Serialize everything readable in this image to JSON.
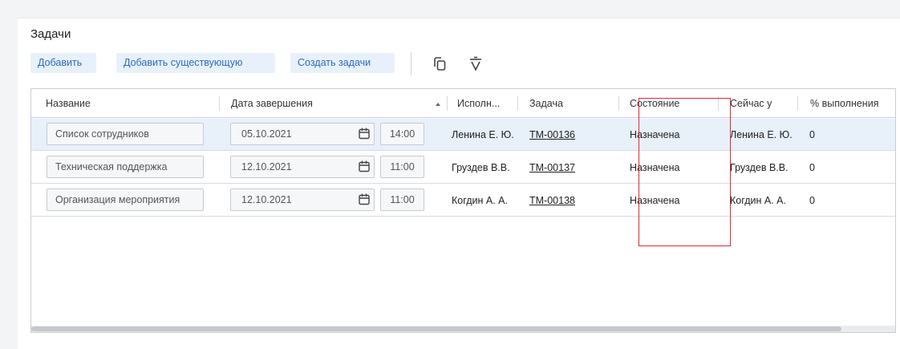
{
  "section": {
    "title": "Задачи"
  },
  "toolbar": {
    "add_label": "Добавить",
    "add_existing_label": "Добавить существующую",
    "create_label": "Создать задачи",
    "copy_icon": "copy-icon",
    "delete_icon": "trash-icon"
  },
  "table": {
    "headers": {
      "name": "Название",
      "due_date": "Дата завершения",
      "executor": "Исполн...",
      "task": "Задача",
      "state": "Состояние",
      "current": "Сейчас у",
      "percent": "% выполнения"
    },
    "rows": [
      {
        "name": "Список сотрудников",
        "date": "05.10.2021",
        "time": "14:00",
        "executor": "Ленина Е. Ю.",
        "task": "TM-00136",
        "state": "Назначена",
        "current": "Ленина Е. Ю.",
        "percent": "0"
      },
      {
        "name": "Техническая поддержка",
        "date": "12.10.2021",
        "time": "11:00",
        "executor": "Груздев В.В.",
        "task": "TM-00137",
        "state": "Назначена",
        "current": "Груздев В.В.",
        "percent": "0"
      },
      {
        "name": "Организация мероприятия",
        "date": "12.10.2021",
        "time": "11:00",
        "executor": "Когдин А. А.",
        "task": "TM-00138",
        "state": "Назначена",
        "current": "Когдин А. А.",
        "percent": "0"
      }
    ]
  },
  "colors": {
    "accent": "#2b6cbf",
    "button_bg": "#e8f1fb",
    "selected_row": "#e8f0fa",
    "highlight": "#e0293a"
  }
}
